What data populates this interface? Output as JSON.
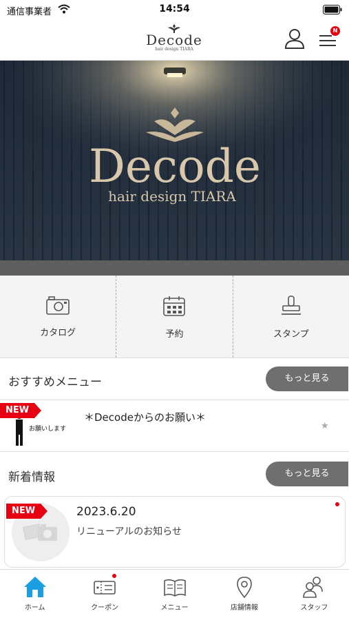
{
  "status": {
    "carrier": "通信事業者",
    "time": "14:54"
  },
  "header": {
    "logo_text": "Decode",
    "logo_sub": "hair design TIARA",
    "menu_badge": "N"
  },
  "hero": {
    "sign_text": "Decode",
    "sign_sub": "hair design TIARA"
  },
  "quicknav": [
    {
      "label": "カタログ",
      "icon": "camera-icon"
    },
    {
      "label": "予約",
      "icon": "calendar-icon"
    },
    {
      "label": "スタンプ",
      "icon": "stamp-icon"
    }
  ],
  "recommend": {
    "section_title": "おすすめメニュー",
    "more_label": "もっと見る",
    "new_label": "NEW",
    "item_title": "＊Decodeからのお願い＊",
    "thumb_text": "お願いします",
    "star": "★"
  },
  "news": {
    "section_title": "新着情報",
    "more_label": "もっと見る",
    "new_label": "NEW",
    "date": "2023.6.20",
    "title": "リニューアルのお知らせ"
  },
  "tabs": [
    {
      "label": "ホーム",
      "icon": "home-icon",
      "active": true
    },
    {
      "label": "クーポン",
      "icon": "coupon-icon"
    },
    {
      "label": "メニュー",
      "icon": "book-icon"
    },
    {
      "label": "店舗情報",
      "icon": "map-pin-icon"
    },
    {
      "label": "スタッフ",
      "icon": "staff-icon"
    }
  ],
  "colors": {
    "accent": "#e60012",
    "active_tab": "#1aa0e0",
    "button_gray": "#6f6f6f"
  }
}
